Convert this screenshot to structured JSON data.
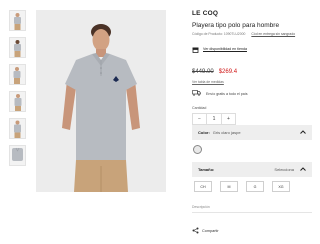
{
  "product": {
    "brand": "LE COQ",
    "title": "Playera tipo polo para hombre",
    "code_label": "Código de Producto: 1090TLU2000",
    "consult_link": "Cód en entrega sin sangrado",
    "store_link": "Ver disponibilidad en tienda",
    "old_price": "$449.00",
    "new_price": "$269.4",
    "sizes_guide_link": "Ver tabla de medidas",
    "shipping_text": "Envío gratis a todo el país",
    "quantity_label": "Cantidad",
    "quantity_minus": "−",
    "quantity_value": "1",
    "quantity_plus": "+",
    "color_label": "Color:",
    "color_value": "Gris claro jaspe",
    "size_label": "Tamaño:",
    "size_selected": "Selecciona",
    "sizes": [
      "CH",
      "M",
      "G",
      "XG"
    ],
    "description_label": "Descripción",
    "share_label": "Compartir"
  },
  "colors": {
    "accent_red": "#d01717",
    "accordion_bg": "#eeeeee",
    "shirt_grey": "#b7bbc1",
    "pants_khaki": "#c8a37a"
  },
  "icons": {
    "store": "store-icon",
    "truck": "truck-icon",
    "chevron": "chevron-up-icon",
    "share": "share-icon"
  }
}
